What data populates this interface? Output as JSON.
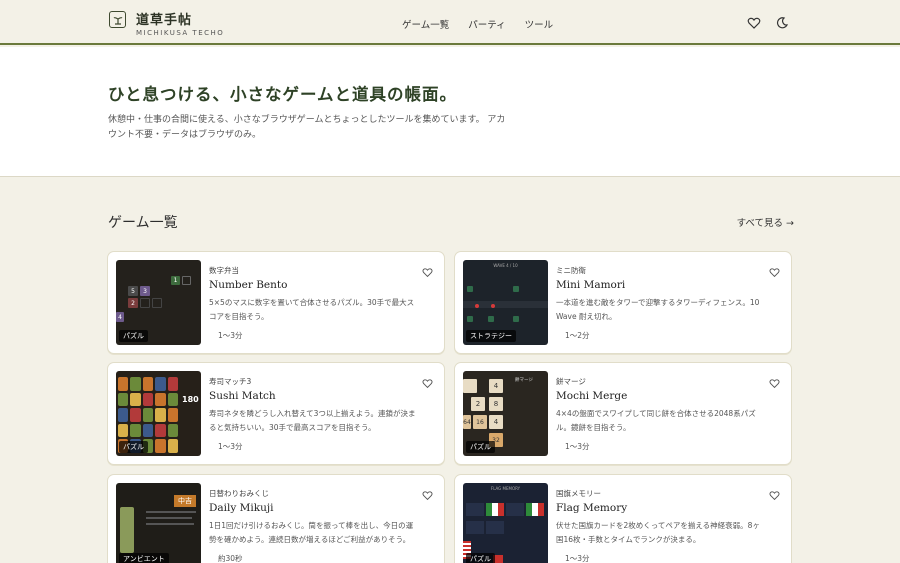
{
  "header": {
    "brand": "道草手帖",
    "brand_sub": "MICHIKUSA TECHO",
    "nav": [
      "ゲーム一覧",
      "パーティ",
      "ツール"
    ]
  },
  "hero": {
    "title": "ひと息つける、小さなゲームと道具の帳面。",
    "desc": "休憩中・仕事の合間に使える、小さなブラウザゲームとちょっとしたツールを集めています。 アカウント不要・データはブラウザのみ。"
  },
  "section": {
    "title": "ゲーム一覧",
    "see_all": "すべて見る →"
  },
  "cards": [
    {
      "cat": "数字弁当",
      "title": "Number Bento",
      "desc": "5×5のマスに数字を置いて合体させるパズル。30手で最大スコアを目指そう。",
      "time": "1〜3分",
      "tag": "パズル"
    },
    {
      "cat": "ミニ防衛",
      "title": "Mini Mamori",
      "desc": "一本道を進む敵をタワーで迎撃するタワーディフェンス。10 Wave 耐え切れ。",
      "time": "1〜2分",
      "tag": "ストラテジー"
    },
    {
      "cat": "寿司マッチ3",
      "title": "Sushi Match",
      "desc": "寿司ネタを隣どうし入れ替えて3つ以上揃えよう。連鎖が決まると気持ちいい。30手で最高スコアを目指そう。",
      "time": "1〜3分",
      "tag": "パズル"
    },
    {
      "cat": "餅マージ",
      "title": "Mochi Merge",
      "desc": "4×4の盤面でスワイプして同じ餅を合体させる2048系パズル。鏡餅を目指そう。",
      "time": "1〜3分",
      "tag": "パズル"
    },
    {
      "cat": "日替わりおみくじ",
      "title": "Daily Mikuji",
      "desc": "1日1回だけ引けるおみくじ。筒を振って棒を出し、今日の運勢を確かめよう。連続日数が増えるほどご利益がありそう。",
      "time": "約30秒",
      "tag": "アンビエント"
    },
    {
      "cat": "国旗メモリー",
      "title": "Flag Memory",
      "desc": "伏せた国旗カードを2枚めくってペアを揃える神経衰弱。8ヶ国16枚・手数とタイムでランクが決まる。",
      "time": "1〜3分",
      "tag": "パズル"
    }
  ],
  "thumb_text": {
    "bento": [
      "5",
      "3",
      "2",
      "1",
      "4"
    ],
    "mamori_header": "WAVE 4 / 10",
    "sushi_score": "180",
    "mochi_header": "餅マージ",
    "mochi_tiles": [
      "4",
      "2",
      "8",
      "16",
      "4",
      "32",
      "64"
    ],
    "mikuji_badge": "中吉",
    "flag_header": "FLAG MEMORY"
  },
  "colors": {
    "accent": "#6b7a3c",
    "hero_title": "#2e4226",
    "background": "#f3f1e7"
  }
}
